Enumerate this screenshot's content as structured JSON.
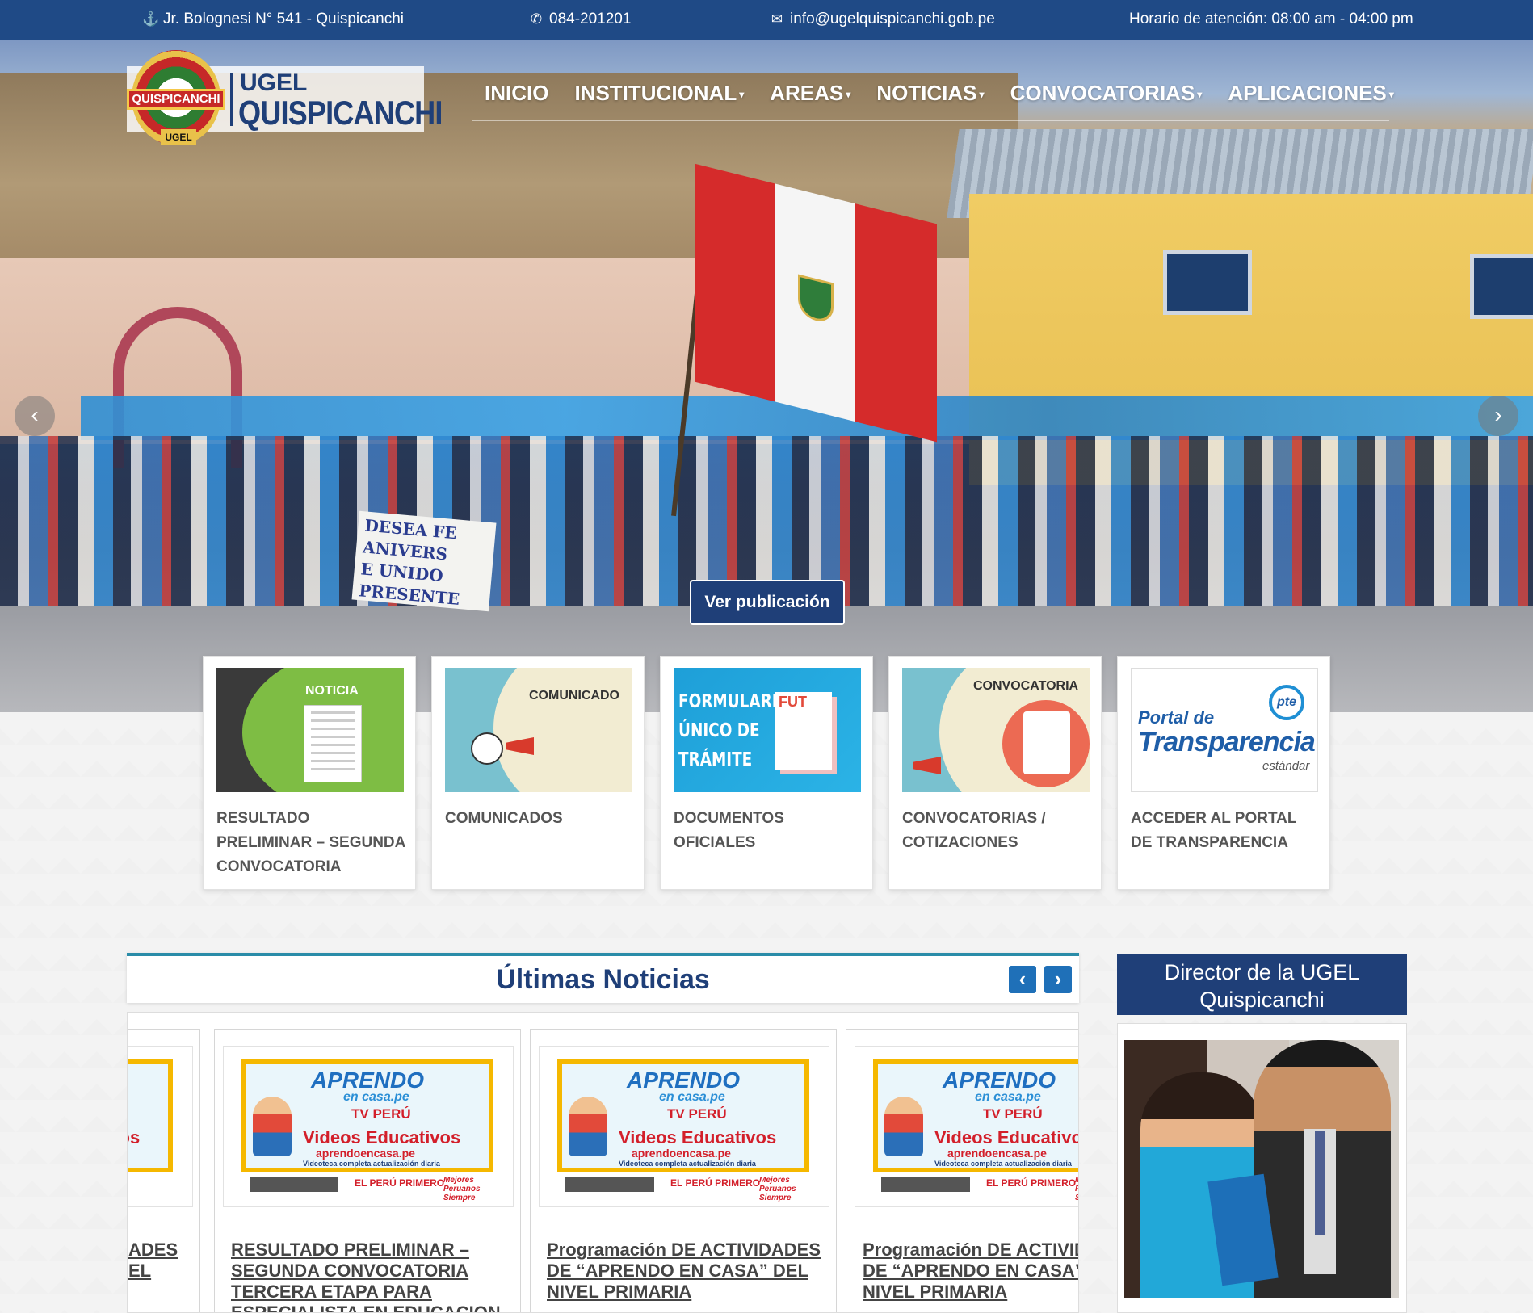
{
  "topbar": {
    "address": "Jr. Bolognesi N° 541 - Quispicanchi",
    "phone": "084-201201",
    "email": "info@ugelquispicanchi.gob.pe",
    "hours": "Horario de atención: 08:00 am - 04:00 pm",
    "icons": [
      "location-icon",
      "phone-icon",
      "email-icon"
    ]
  },
  "logo": {
    "line1": "UGEL",
    "line2": "QUISPICANCHI",
    "seal_band": "QUISPICANCHI",
    "seal_foot": "UGEL"
  },
  "nav": {
    "items": [
      {
        "label": "INICIO",
        "dropdown": false
      },
      {
        "label": "INSTITUCIONAL",
        "dropdown": true
      },
      {
        "label": "AREAS",
        "dropdown": true
      },
      {
        "label": "NOTICIAS",
        "dropdown": true
      },
      {
        "label": "CONVOCATORIAS",
        "dropdown": true
      },
      {
        "label": "APLICACIONES",
        "dropdown": true
      }
    ]
  },
  "hero": {
    "button": "Ver publicación",
    "banner_text": "DESEA FE\nANIVERS\nE UNIDO\nPRESENTE",
    "prev": "‹",
    "next": "›"
  },
  "cards": [
    {
      "thumb_label": "NOTICIA",
      "caption": "RESULTADO PRELIMINAR – SEGUNDA CONVOCATORIA"
    },
    {
      "thumb_label": "COMUNICADO",
      "caption": "COMUNICADOS"
    },
    {
      "thumb_label": "FORMULARIO ÚNICO DE TRÁMITE",
      "thumb_badge": "FUT",
      "caption": "DOCUMENTOS OFICIALES"
    },
    {
      "thumb_label": "CONVOCATORIA",
      "caption": "CONVOCATORIAS / COTIZACIONES"
    },
    {
      "thumb_label_1": "Portal de",
      "thumb_label_2": "Transparencia",
      "thumb_label_3": "estándar",
      "thumb_badge": "pte",
      "caption": "ACCEDER AL PORTAL DE TRANSPARENCIA"
    }
  ],
  "news": {
    "title": "Últimas Noticias",
    "prev": "‹",
    "next": "›",
    "aec": {
      "t1": "APRENDO",
      "t2": "en casa.pe",
      "t3": "TV PERÚ",
      "t4": "Videos Educativos",
      "t5": "aprendoencasa.pe",
      "t6": "Videoteca completa actualización diaria",
      "foot": "EL PERÚ PRIMERO",
      "foot2": "Mejores Peruanos Siempre"
    },
    "items": [
      {
        "title": "ADES\nEL"
      },
      {
        "title": "RESULTADO PRELIMINAR – SEGUNDA CONVOCATORIA TERCERA ETAPA PARA ESPECIALISTA EN EDUCACION"
      },
      {
        "title": "Programación DE ACTIVIDADES DE “APRENDO EN CASA” DEL NIVEL PRIMARIA"
      },
      {
        "title": "Programación DE ACTIVIDADES DE “APRENDO EN CASA” DEL NIVEL PRIMARIA"
      }
    ]
  },
  "director": {
    "title": "Director de la UGEL Quispicanchi"
  }
}
